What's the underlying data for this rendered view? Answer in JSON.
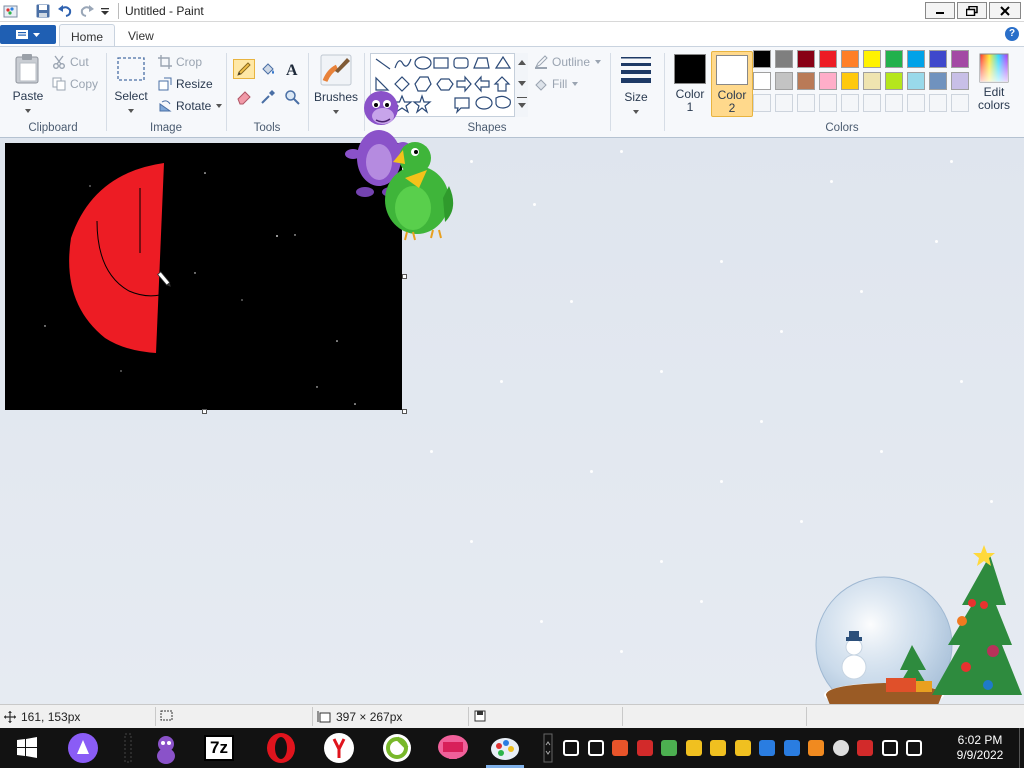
{
  "window": {
    "title": "Untitled - Paint"
  },
  "tabs": [
    {
      "label": "Home"
    },
    {
      "label": "View"
    }
  ],
  "ribbon": {
    "clipboard": {
      "label": "Clipboard",
      "paste": "Paste",
      "cut": "Cut",
      "copy": "Copy"
    },
    "image": {
      "label": "Image",
      "select": "Select",
      "crop": "Crop",
      "resize": "Resize",
      "rotate": "Rotate"
    },
    "tools": {
      "label": "Tools"
    },
    "brushes": {
      "label": "Brushes"
    },
    "shapes": {
      "label": "Shapes",
      "outline": "Outline",
      "fill": "Fill"
    },
    "size": {
      "label": "Size"
    },
    "colors": {
      "label": "Colors",
      "color1_l1": "Color",
      "color1_l2": "1",
      "color2_l1": "Color",
      "color2_l2": "2",
      "edit_l1": "Edit",
      "edit_l2": "colors",
      "color1": "#000000",
      "color2": "#ffffff",
      "palette_row1": [
        "#000000",
        "#7f7f7f",
        "#880015",
        "#ed1c24",
        "#ff7f27",
        "#fff200",
        "#22b14c",
        "#00a2e8",
        "#3f48cc",
        "#a349a4"
      ],
      "palette_row2": [
        "#ffffff",
        "#c3c3c3",
        "#b97a57",
        "#ffaec9",
        "#ffc90e",
        "#efe4b0",
        "#b5e61d",
        "#99d9ea",
        "#7092be",
        "#c8bfe7"
      ]
    }
  },
  "status": {
    "cursor_pos": "161, 153px",
    "canvas_size": "397 × 267px"
  },
  "taskbar": {
    "clock_time": "6:02 PM",
    "clock_date": "9/9/2022",
    "sevenzip": "7z"
  },
  "canvas": {
    "shape_color": "#ed1c24",
    "background": "#000000"
  }
}
